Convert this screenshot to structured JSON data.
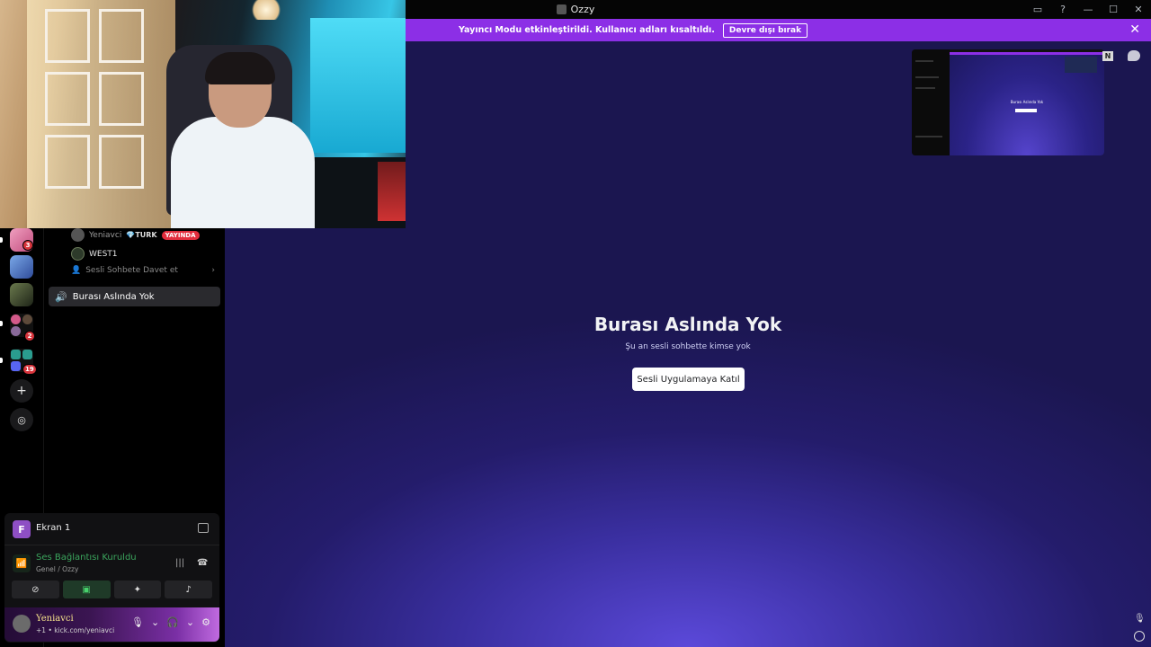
{
  "window": {
    "title": "Ozzy"
  },
  "banner": {
    "message": "Yayıncı Modu etkinleştirildi. Kullanıcı adları kısaltıldı.",
    "button": "Devre dışı bırak"
  },
  "stage": {
    "title": "Burası Aslında Yok",
    "subtitle": "Şu an sesli sohbette kimse yok",
    "join_button": "Sesli Uygulamaya Katıl"
  },
  "preview": {
    "title": "Burası Aslında Yok",
    "badge": "N"
  },
  "servers": [
    {
      "badge": "3"
    },
    {
      "badge": ""
    },
    {
      "badge": ""
    },
    {
      "badge": "2"
    },
    {
      "badge": "19"
    }
  ],
  "voice_users": [
    {
      "name": "Yeniavci",
      "tag": "TURK",
      "live": "YAYINDA"
    },
    {
      "name": "WEST1"
    }
  ],
  "invite": "Sesli Sohbete Davet et",
  "active_channel": "Burası Aslında Yok",
  "voice_panel": {
    "screen_label": "Ekran 1",
    "screen_avatar": "F",
    "status": "Ses Bağlantısı Kuruldu",
    "location": "Genel / Ozzy"
  },
  "user": {
    "name": "Yeniavci",
    "status": "+1 • kick.com/yeniavci"
  }
}
